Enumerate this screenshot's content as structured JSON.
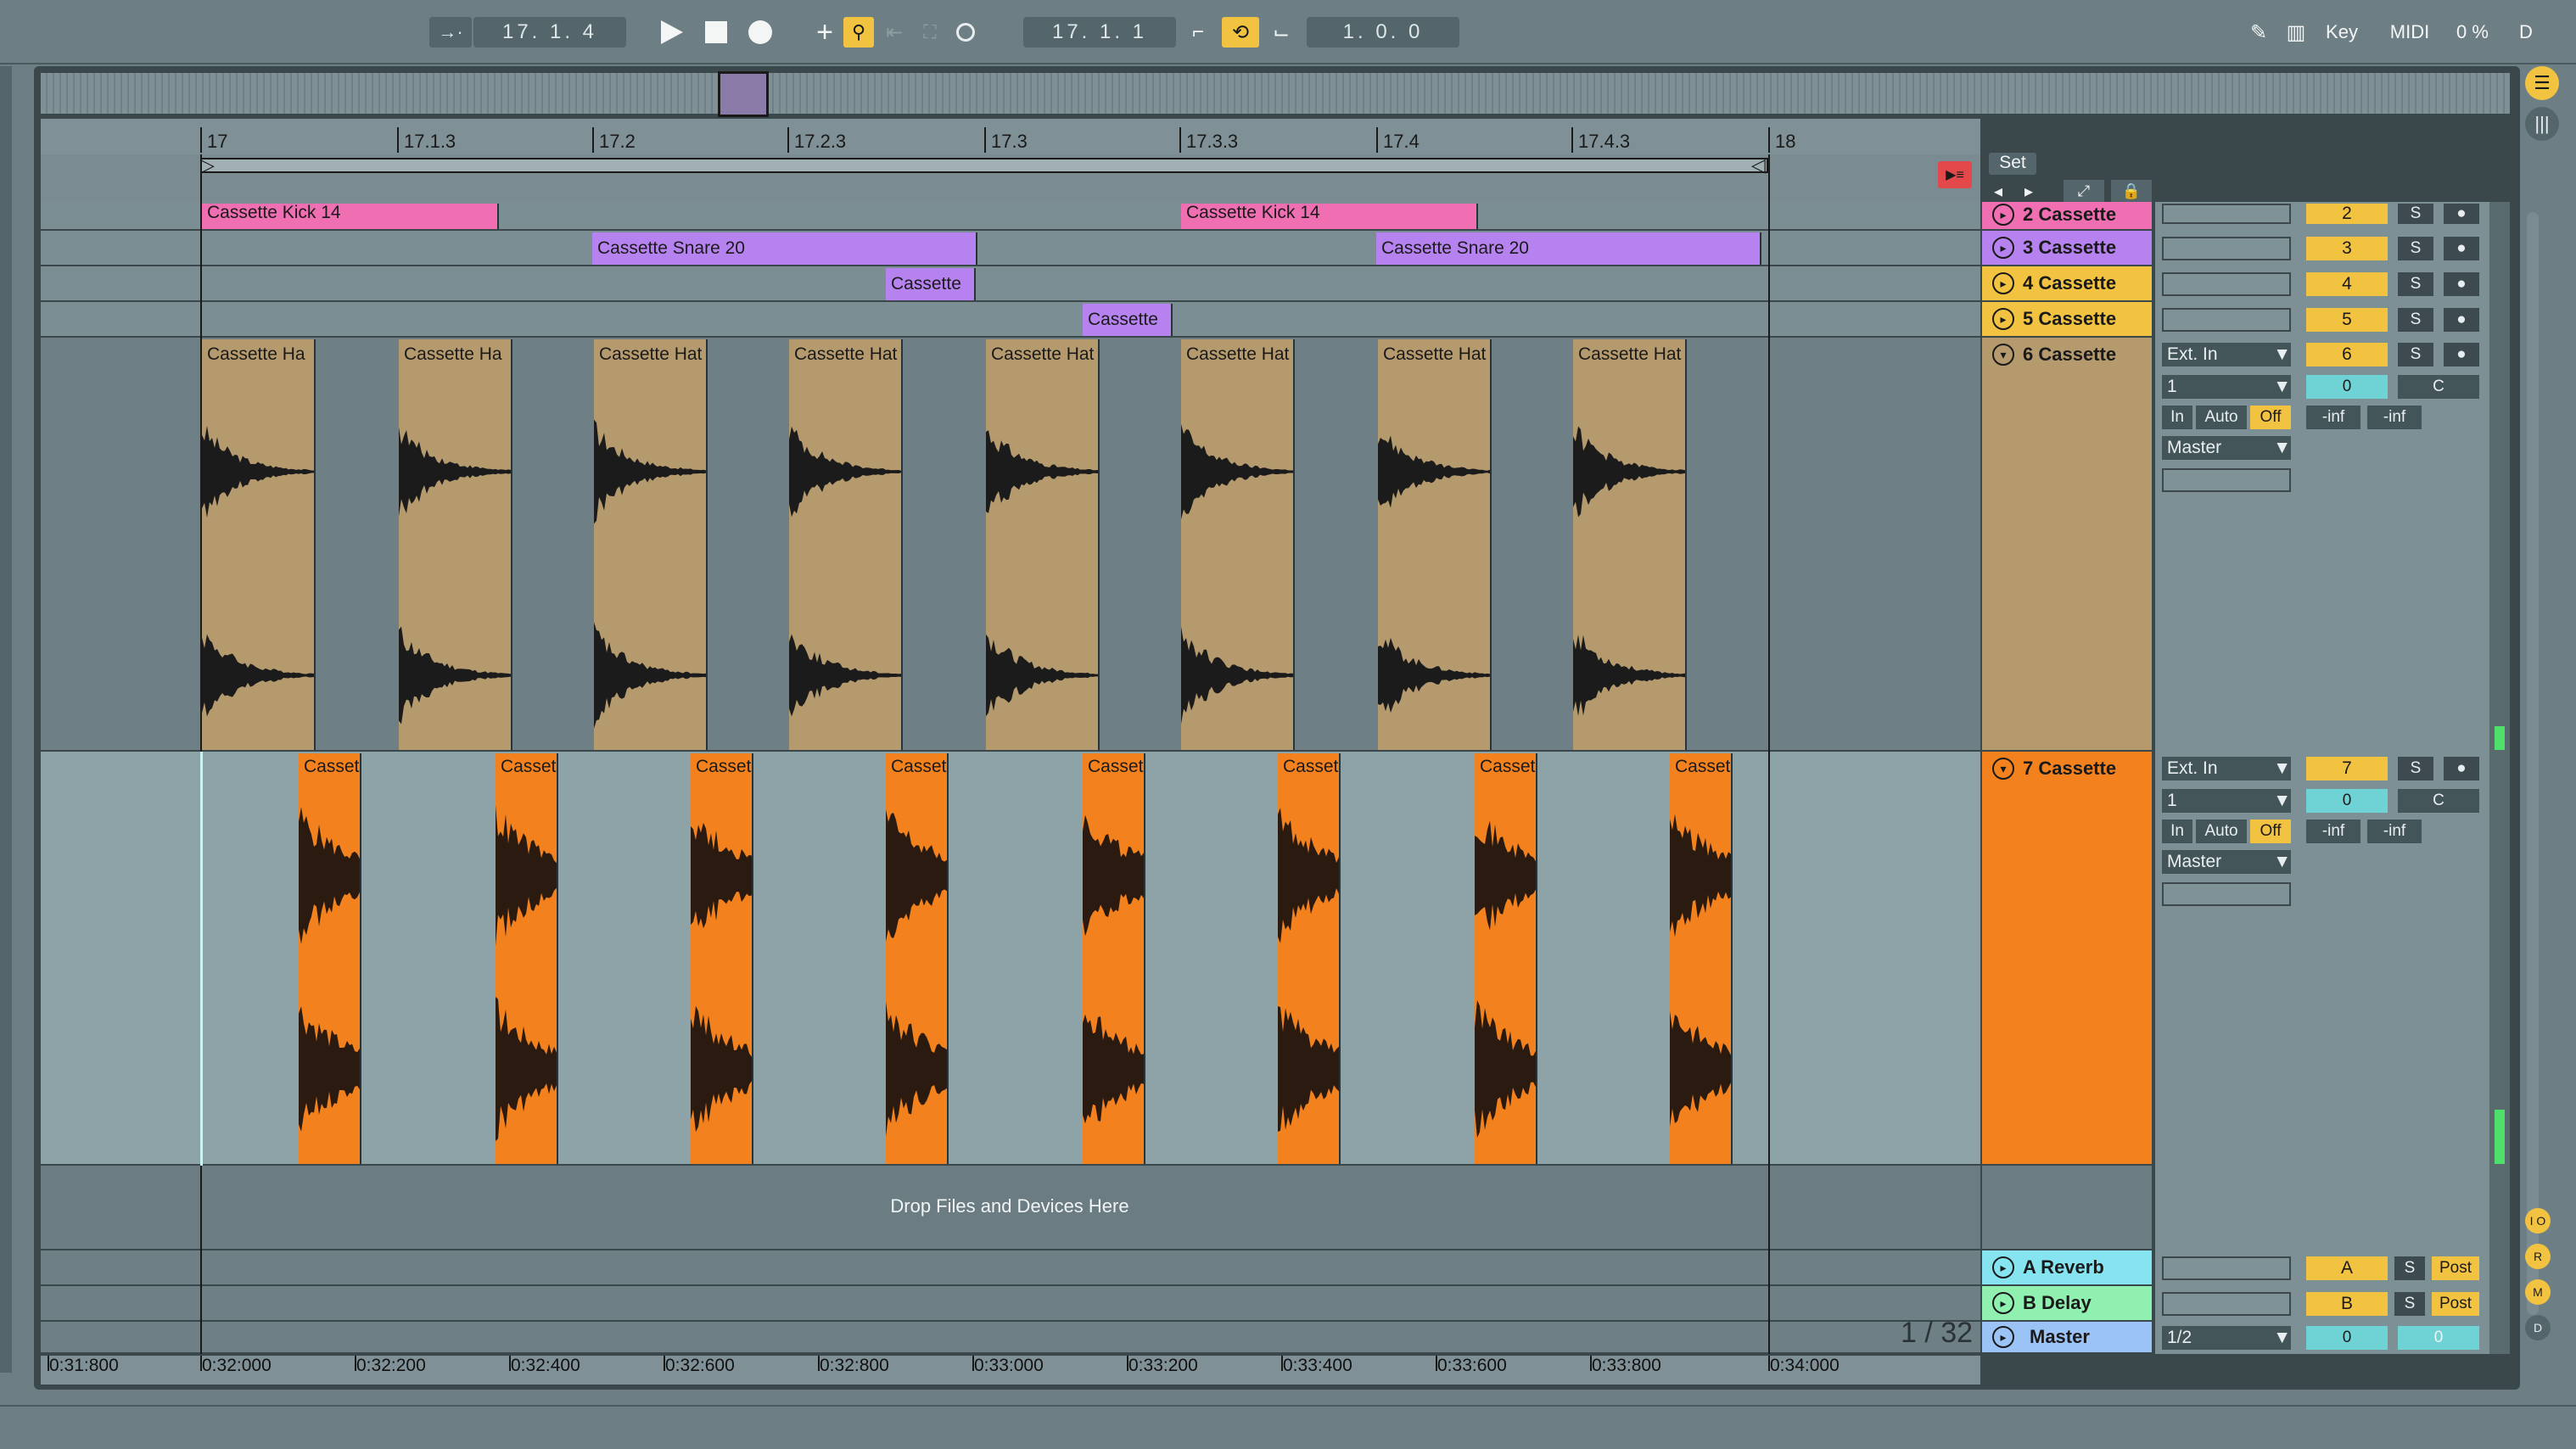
{
  "transport": {
    "arrangement_position": "17.   1.   4",
    "loop_start": "17.   1.   1",
    "loop_length": "1.   0.   0",
    "key_label": "Key",
    "midi_label": "MIDI",
    "cpu_load": "0 %",
    "d_label": "D"
  },
  "ruler": {
    "bars": [
      "17",
      "17.1.3",
      "17.2",
      "17.2.3",
      "17.3",
      "17.3.3",
      "17.4",
      "17.4.3",
      "18"
    ],
    "set_label": "Set"
  },
  "tracks": [
    {
      "name": "2 Cassette",
      "number": "2",
      "color": "#f06fb2"
    },
    {
      "name": "3 Cassette",
      "number": "3",
      "color": "#b682f0"
    },
    {
      "name": "4 Cassette",
      "number": "4",
      "color": "#f2c341"
    },
    {
      "name": "5 Cassette",
      "number": "5",
      "color": "#f2c341"
    },
    {
      "name": "6 Cassette",
      "number": "6",
      "color": "#b59a6e",
      "input": "Ext. In",
      "channel": "1",
      "monitor_in": "In",
      "monitor_auto": "Auto",
      "monitor_off": "Off",
      "output": "Master",
      "volume": "-inf",
      "volume2": "-inf",
      "send": "0",
      "pan": "C"
    },
    {
      "name": "7 Cassette",
      "number": "7",
      "color": "#f3821e",
      "input": "Ext. In",
      "channel": "1",
      "monitor_in": "In",
      "monitor_auto": "Auto",
      "monitor_off": "Off",
      "output": "Master",
      "volume": "-inf",
      "volume2": "-inf",
      "send": "0",
      "pan": "C"
    }
  ],
  "returns": [
    {
      "name": "A Reverb",
      "letter": "A",
      "post": "Post"
    },
    {
      "name": "B Delay",
      "letter": "B",
      "post": "Post"
    }
  ],
  "master": {
    "name": "Master",
    "quantize": "1/2",
    "value": "0",
    "value2": "0"
  },
  "clips": {
    "kick": "Cassette Kick 14",
    "snare": "Cassette Snare 20",
    "short": "Cassette",
    "hat": "Cassette Ha",
    "hat2": "Cassette Hat",
    "bottom": "Casset"
  },
  "solo_label": "S",
  "drop_zone": "Drop Files and Devices Here",
  "grid_label": "1 / 32",
  "time_ruler": [
    "0:31:800",
    "0:32:000",
    "0:32:200",
    "0:32:400",
    "0:32:600",
    "0:32:800",
    "0:33:000",
    "0:33:200",
    "0:33:400",
    "0:33:600",
    "0:33:800",
    "0:34:000"
  ],
  "side_buttons": [
    "I O",
    "R",
    "M",
    "D"
  ]
}
